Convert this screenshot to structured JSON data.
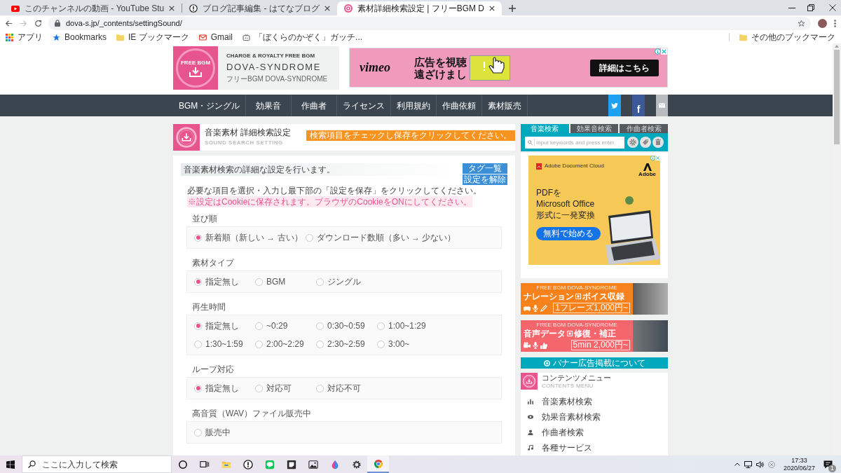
{
  "browser": {
    "tabs": [
      {
        "kind": "video",
        "title": "このチャンネルの動画 - YouTube Stu",
        "selected": false
      },
      {
        "kind": "blog",
        "title": "ブログ記事編集 - はてなブログ",
        "selected": false
      },
      {
        "kind": "site",
        "title": "素材詳細検索設定 | フリーBGM D",
        "selected": true
      }
    ],
    "address": "dova-s.jp/_contents/settingSound/",
    "bookmarks": [
      {
        "kind": "apps",
        "label": "アプリ"
      },
      {
        "kind": "star",
        "label": "Bookmarks"
      },
      {
        "kind": "folder",
        "label": "IE ブックマーク"
      },
      {
        "kind": "mail",
        "label": "Gmail"
      },
      {
        "kind": "page",
        "label": "「ぼくらのかぞく」ガッチ..."
      }
    ],
    "other_bookmarks": "その他のブックマーク"
  },
  "site": {
    "logo_badge": "FREE BGM",
    "tagline": "CHARGE & ROYALTY FREE BGM",
    "name": "DOVA-SYNDROME",
    "subtitle": "フリーBGM DOVA-SYNDROME"
  },
  "header_ad": {
    "brand": "vimeo",
    "headline": [
      "広告を視聴",
      "遠ざけまし"
    ],
    "button": "詳細はこちら"
  },
  "nav": {
    "items": [
      "BGM・ジングル",
      "効果音",
      "作曲者",
      "ライセンス",
      "利用規約",
      "作曲依頼",
      "素材販売"
    ],
    "social": [
      {
        "kind": "twitter"
      },
      {
        "kind": "facebook",
        "glyph": "f"
      },
      {
        "kind": "mail"
      }
    ]
  },
  "page_header": {
    "title": "音楽素材 詳細検索設定",
    "subtitle": "SOUND SEARCH SETTING",
    "notice": "検索項目をチェックし保存をクリックしてください。"
  },
  "settings": {
    "intro": "音楽素材検索の詳細な設定を行います。",
    "buttons": [
      "タグ一覧",
      "設定を解除"
    ],
    "instruction": "必要な項目を選択・入力し最下部の「設定を保存」をクリックしてください。",
    "cookie_note": "※設定はCookieに保存されます。ブラウザのCookieをONにしてください。",
    "groups": [
      {
        "label": "並び順",
        "options": [
          {
            "label": "新着順（新しい → 古い）",
            "selected": true
          },
          {
            "label": "ダウンロード数順（多い → 少ない）",
            "selected": false
          }
        ]
      },
      {
        "label": "素材タイプ",
        "options": [
          {
            "label": "指定無し",
            "selected": true
          },
          {
            "label": "BGM",
            "selected": false
          },
          {
            "label": "ジングル",
            "selected": false
          }
        ]
      },
      {
        "label": "再生時間",
        "options": [
          {
            "label": "指定無し",
            "selected": true
          },
          {
            "label": "~0:29",
            "selected": false
          },
          {
            "label": "0:30~0:59",
            "selected": false
          },
          {
            "label": "1:00~1:29",
            "selected": false
          },
          {
            "label": "1:30~1:59",
            "selected": false
          },
          {
            "label": "2:00~2:29",
            "selected": false
          },
          {
            "label": "2:30~2:59",
            "selected": false
          },
          {
            "label": "3:00~",
            "selected": false
          }
        ]
      },
      {
        "label": "ループ対応",
        "options": [
          {
            "label": "指定無し",
            "selected": true
          },
          {
            "label": "対応可",
            "selected": false
          },
          {
            "label": "対応不可",
            "selected": false
          }
        ]
      },
      {
        "label": "高音質（WAV）ファイル販売中",
        "options": [
          {
            "label": "販売中",
            "selected": false
          }
        ]
      }
    ]
  },
  "sidebar": {
    "search": {
      "tabs": [
        {
          "label": "音楽検索",
          "selected": true
        },
        {
          "label": "効果音検索",
          "selected": false
        },
        {
          "label": "作曲者検索",
          "selected": false
        }
      ],
      "placeholder": "Input keywords and press enter.",
      "actions": [
        {
          "kind": "settings"
        },
        {
          "kind": "tags"
        },
        {
          "kind": "delete"
        }
      ]
    },
    "ad": {
      "brand": "Adobe Document Cloud",
      "logo_label": "Adobe",
      "headline": [
        "PDFを",
        "Microsoft Office",
        "形式に一発変換"
      ],
      "button": "無料で始める"
    },
    "banners": [
      {
        "kicker": "FREE BGM DOVA-SYNDROME",
        "title": [
          "ナレーション",
          "ボイス収録"
        ],
        "icons": [
          {
            "kind": "gamepad"
          },
          {
            "kind": "mic"
          },
          {
            "kind": "pen"
          }
        ],
        "price": "1フレーズ1,000円~",
        "color": "#f7821b"
      },
      {
        "kicker": "FREE BGM DOVA-SYNDROME",
        "title": [
          "音声データ",
          "修復・補正"
        ],
        "icons": [
          {
            "kind": "camera"
          },
          {
            "kind": "mic"
          },
          {
            "kind": "hand"
          }
        ],
        "price": "5min 2,000円~",
        "color": "#f4666b"
      }
    ],
    "banner_info": "バナー広告掲載について",
    "menu": {
      "title": "コンテンツメニュー",
      "subtitle": "CONTENTS MENU",
      "items": [
        {
          "kind": "music",
          "label": "音楽素材検索"
        },
        {
          "kind": "effects",
          "label": "効果音素材検索"
        },
        {
          "kind": "composer",
          "label": "作曲者検索"
        },
        {
          "kind": "services",
          "label": "各種サービス"
        }
      ]
    }
  },
  "taskbar": {
    "search_placeholder": "ここに入力して検索",
    "apps": [
      {
        "kind": "cortana",
        "active": false
      },
      {
        "kind": "taskview",
        "active": false
      },
      {
        "kind": "explorer",
        "active": false
      },
      {
        "kind": "circle",
        "active": false
      },
      {
        "kind": "chat",
        "active": false
      },
      {
        "kind": "notes",
        "active": false
      },
      {
        "kind": "photos",
        "active": false
      },
      {
        "kind": "drop",
        "active": false
      },
      {
        "kind": "settings",
        "active": false
      },
      {
        "kind": "browser",
        "active": true
      }
    ],
    "time": "17:33",
    "date": "2020/06/27",
    "notification_count": "1"
  }
}
